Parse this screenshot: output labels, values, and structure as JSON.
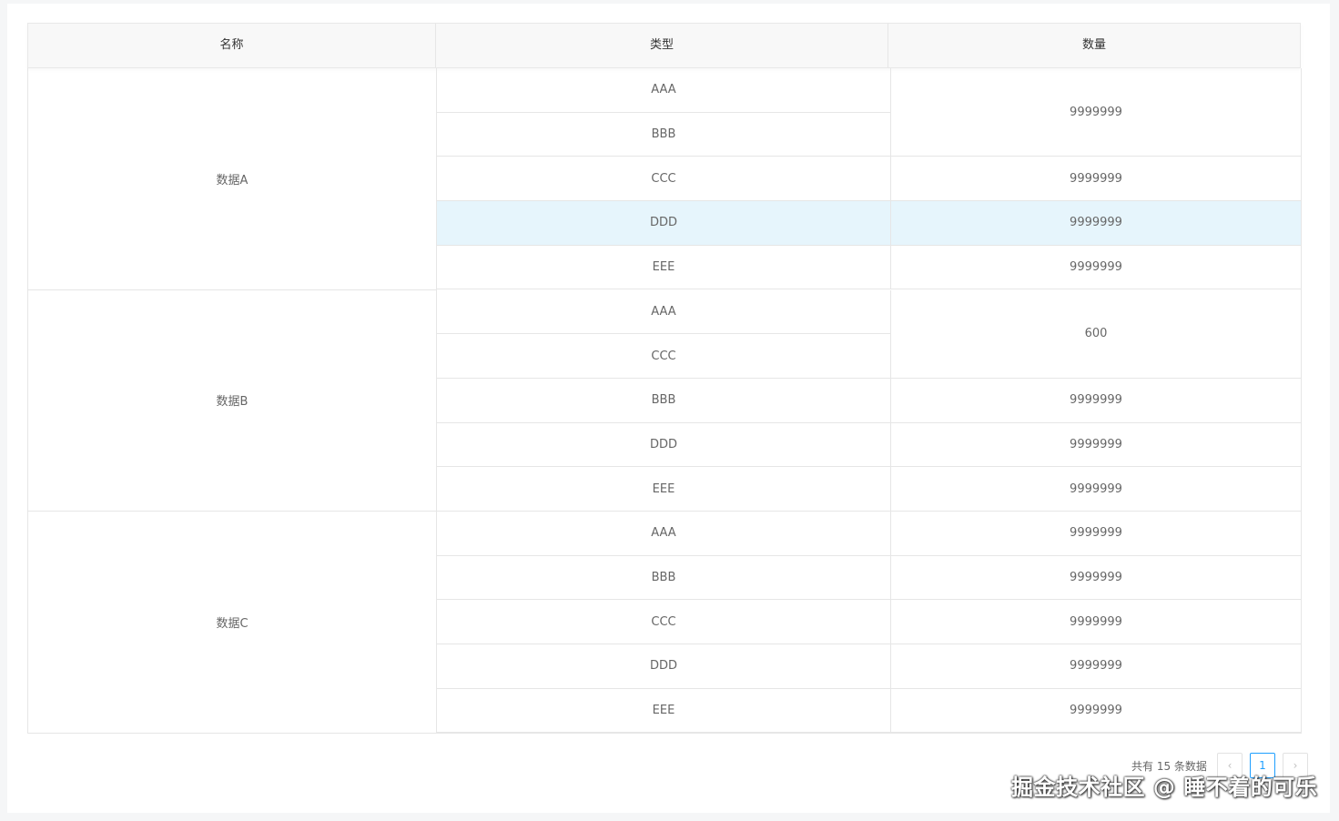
{
  "table": {
    "headers": [
      "名称",
      "类型",
      "数量"
    ],
    "groups": [
      {
        "name": "数据A",
        "rows": [
          {
            "type": "AAA",
            "qty": "9999999",
            "qty_span": 2
          },
          {
            "type": "BBB",
            "qty": null,
            "qty_span": 0
          },
          {
            "type": "CCC",
            "qty": "9999999",
            "qty_span": 1
          },
          {
            "type": "DDD",
            "qty": "9999999",
            "qty_span": 1,
            "highlighted": true
          },
          {
            "type": "EEE",
            "qty": "9999999",
            "qty_span": 1
          }
        ]
      },
      {
        "name": "数据B",
        "rows": [
          {
            "type": "AAA",
            "qty": "600",
            "qty_span": 2
          },
          {
            "type": "CCC",
            "qty": null,
            "qty_span": 0
          },
          {
            "type": "BBB",
            "qty": "9999999",
            "qty_span": 1
          },
          {
            "type": "DDD",
            "qty": "9999999",
            "qty_span": 1
          },
          {
            "type": "EEE",
            "qty": "9999999",
            "qty_span": 1
          }
        ]
      },
      {
        "name": "数据C",
        "rows": [
          {
            "type": "AAA",
            "qty": "9999999",
            "qty_span": 1
          },
          {
            "type": "BBB",
            "qty": "9999999",
            "qty_span": 1
          },
          {
            "type": "CCC",
            "qty": "9999999",
            "qty_span": 1
          },
          {
            "type": "DDD",
            "qty": "9999999",
            "qty_span": 1
          },
          {
            "type": "EEE",
            "qty": "9999999",
            "qty_span": 1
          }
        ]
      }
    ]
  },
  "pagination": {
    "total_text": "共有 15 条数据",
    "prev_icon": "chevron-left-icon",
    "next_icon": "chevron-right-icon",
    "prev_glyph": "‹",
    "next_glyph": "›",
    "current_page": "1"
  },
  "watermark": "掘金技术社区 @ 睡不着的可乐",
  "colors": {
    "highlight_row": "#e6f5fc",
    "active_page": "#1e9fff"
  }
}
